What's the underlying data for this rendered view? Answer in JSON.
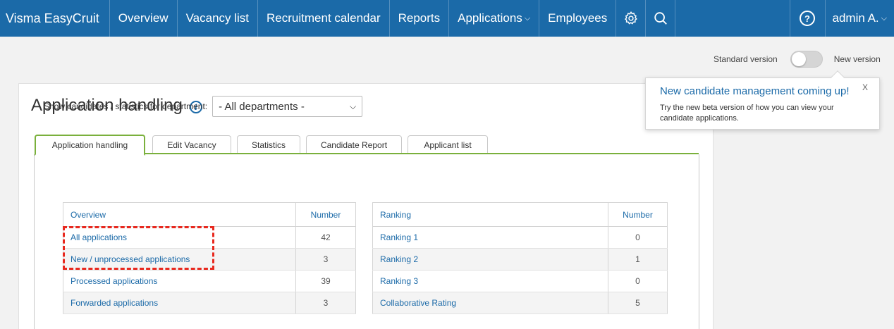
{
  "navbar": {
    "brand": "Visma EasyCruit",
    "items": [
      "Overview",
      "Vacancy list",
      "Recruitment calendar",
      "Reports"
    ],
    "applications_label": "Applications",
    "employees_label": "Employees",
    "help_label": "?",
    "user_label": "admin A."
  },
  "version_toggle": {
    "standard_label": "Standard version",
    "new_label": "New version"
  },
  "popover": {
    "title": "New candidate management coming up!",
    "body": "Try the new beta version of how you can view your candidate applications.",
    "close": "X"
  },
  "page": {
    "title": "Application handling",
    "info": "i"
  },
  "tabs": [
    "Application handling",
    "Edit Vacancy",
    "Statistics",
    "Candidate Report",
    "Applicant list"
  ],
  "department": {
    "label": "Show candidates / statistics for department:",
    "selected": "- All departments -"
  },
  "overview_table": {
    "headers": [
      "Overview",
      "Number"
    ],
    "rows": [
      {
        "label": "All applications",
        "number": "42"
      },
      {
        "label": "New / unprocessed applications",
        "number": "3"
      },
      {
        "label": "Processed applications",
        "number": "39"
      },
      {
        "label": "Forwarded applications",
        "number": "3"
      }
    ]
  },
  "ranking_table": {
    "headers": [
      "Ranking",
      "Number"
    ],
    "rows": [
      {
        "label": "Ranking 1",
        "number": "0"
      },
      {
        "label": "Ranking 2",
        "number": "1"
      },
      {
        "label": "Ranking 3",
        "number": "0"
      },
      {
        "label": "Collaborative Rating",
        "number": "5"
      }
    ]
  },
  "colors": {
    "navbar": "#1b6aa8",
    "link": "#1b6aa8",
    "tab_active_border": "#7ab03c",
    "highlight": "#e8281e"
  }
}
